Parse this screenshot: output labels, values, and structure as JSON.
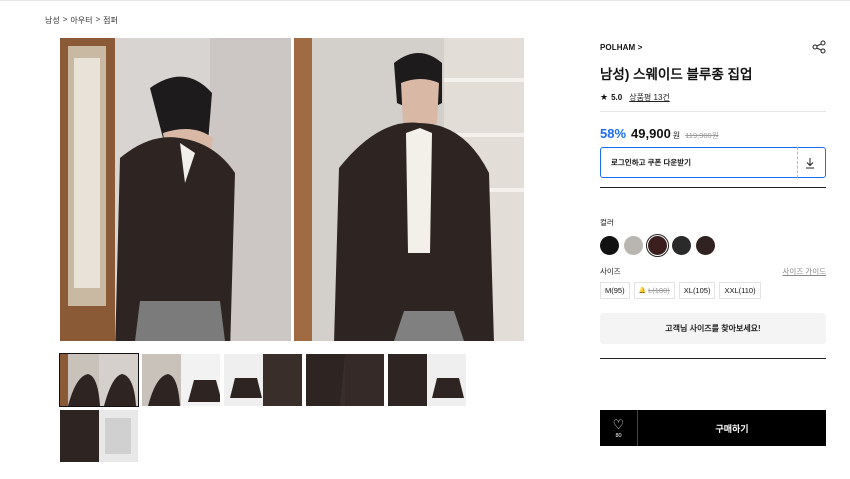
{
  "breadcrumb": [
    "남성",
    "아우터",
    "점퍼"
  ],
  "breadcrumb_sep": ">",
  "product": {
    "brand": "POLHAM >",
    "title": "남성) 스웨이드 블루종 집업",
    "rating": "5.0",
    "reviews": "상품평 13건",
    "discount": "58%",
    "price": "49,900",
    "currency": "원",
    "original_price": "119,900원"
  },
  "coupon": {
    "label": "로그인하고 쿠폰 다운받기",
    "icon": "download-icon"
  },
  "color": {
    "label": "컬러",
    "swatches": [
      "#111111",
      "#b9b5b0",
      "#3b1f1f",
      "#2a2a2a",
      "#2f2220"
    ],
    "selected_index": 2
  },
  "size": {
    "label": "사이즈",
    "guide": "사이즈 가이드",
    "options": [
      {
        "label": "M(95)",
        "sold_out": false
      },
      {
        "label": "L(100)",
        "sold_out": true
      },
      {
        "label": "XL(105)",
        "sold_out": false
      },
      {
        "label": "XXL(110)",
        "sold_out": false
      }
    ]
  },
  "find_size": "고객님 사이즈를 찾아보세요!",
  "buy_bar": {
    "wish_count": "80",
    "buy_label": "구매하기"
  },
  "colors": {
    "accent": "#1a6df0",
    "jacket": "#2e2523",
    "background": "#ffffff"
  }
}
